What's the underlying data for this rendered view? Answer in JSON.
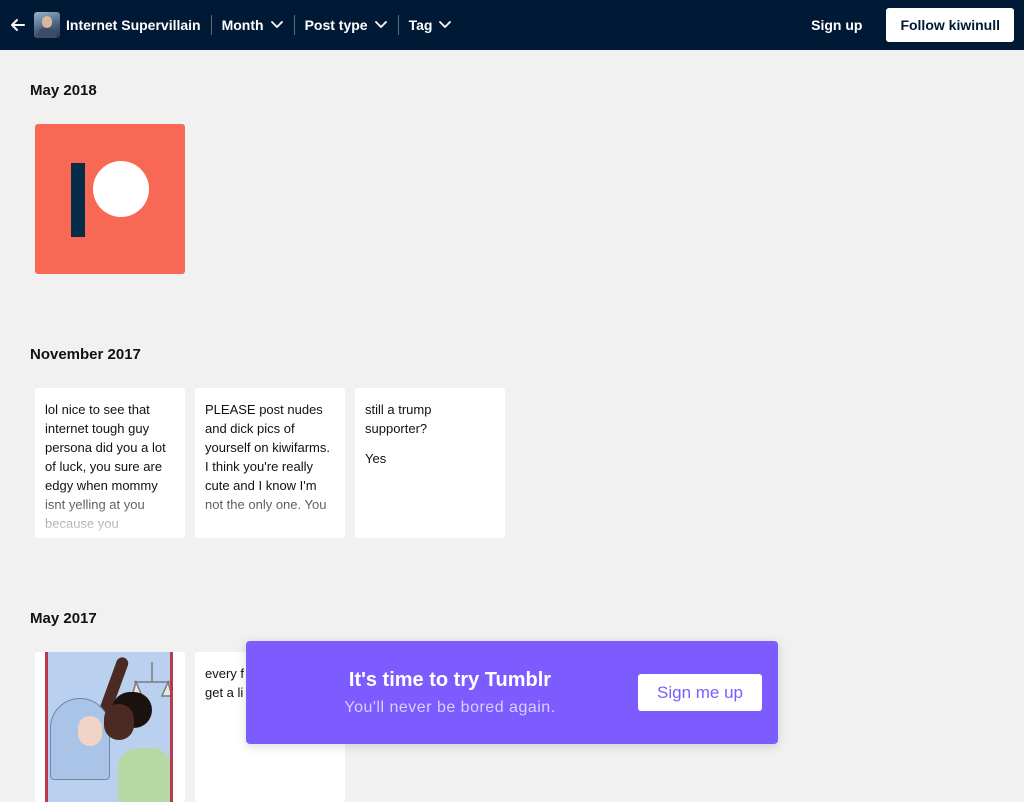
{
  "header": {
    "blog_name": "Internet Supervillain",
    "filters": [
      {
        "label": "Month"
      },
      {
        "label": "Post type"
      },
      {
        "label": "Tag"
      }
    ],
    "signup_label": "Sign up",
    "follow_label": "Follow kiwinull",
    "background_color": "#001935"
  },
  "sections": [
    {
      "title": "May 2018",
      "posts": [
        {
          "type": "image",
          "icon": "patreon-logo-icon",
          "accent_color": "#f96854"
        }
      ]
    },
    {
      "title": "November 2017",
      "posts": [
        {
          "type": "text",
          "text": "lol nice to see that internet tough guy persona did you a lot of luck, you sure are edgy when mommy isnt yelling at you because you"
        },
        {
          "type": "text",
          "text": "PLEASE post nudes and dick pics of yourself on kiwifarms. I think you're really cute and I know I'm not the only one. You"
        },
        {
          "type": "text",
          "text": "still a trump supporter?",
          "answer": "Yes"
        }
      ]
    },
    {
      "title": "May 2017",
      "posts": [
        {
          "type": "image",
          "icon": "illustration-artwork-icon"
        },
        {
          "type": "text",
          "text": "every f kiwifar anime get a li"
        }
      ]
    }
  ],
  "promo": {
    "title": "It's time to try Tumblr",
    "subtitle": "You'll never be bored again.",
    "button_label": "Sign me up",
    "background_color": "#7c5cff"
  }
}
